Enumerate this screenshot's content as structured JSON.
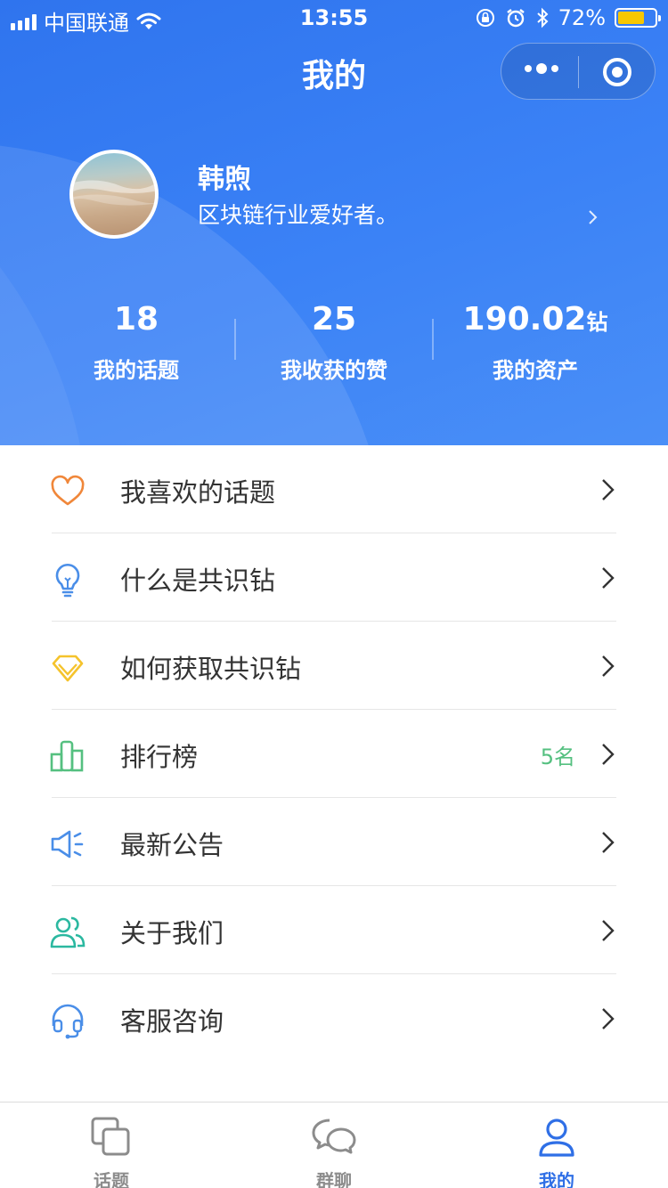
{
  "status_bar": {
    "carrier": "中国联通",
    "time": "13:55",
    "battery": "72%",
    "battery_level": 0.72
  },
  "nav": {
    "title": "我的"
  },
  "profile": {
    "name": "韩煦",
    "bio": "区块链行业爱好者。"
  },
  "stats": [
    {
      "value": "18",
      "unit": "",
      "label": "我的话题"
    },
    {
      "value": "25",
      "unit": "",
      "label": "我收获的赞"
    },
    {
      "value": "190.02",
      "unit": "钻",
      "label": "我的资产"
    }
  ],
  "menu": [
    {
      "label": "我喜欢的话题",
      "icon": "heart-icon",
      "color": "#f0873a",
      "extra": ""
    },
    {
      "label": "什么是共识钻",
      "icon": "lightbulb-icon",
      "color": "#4a8ee8",
      "extra": ""
    },
    {
      "label": "如何获取共识钻",
      "icon": "diamond-icon",
      "color": "#f5c32c",
      "extra": ""
    },
    {
      "label": "排行榜",
      "icon": "bar-chart-icon",
      "color": "#55c080",
      "extra": "5名"
    },
    {
      "label": "最新公告",
      "icon": "megaphone-icon",
      "color": "#4a8ee8",
      "extra": ""
    },
    {
      "label": "关于我们",
      "icon": "users-icon",
      "color": "#2bb8a0",
      "extra": ""
    },
    {
      "label": "客服咨询",
      "icon": "headset-icon",
      "color": "#4a8ee8",
      "extra": ""
    }
  ],
  "tabs": [
    {
      "label": "话题",
      "icon": "topic-icon",
      "active": false
    },
    {
      "label": "群聊",
      "icon": "chat-icon",
      "active": false
    },
    {
      "label": "我的",
      "icon": "user-icon",
      "active": true
    }
  ],
  "colors": {
    "header_blue": "#3b82f6",
    "active_tab": "#2f6fe6",
    "rank_green": "#55c080"
  }
}
